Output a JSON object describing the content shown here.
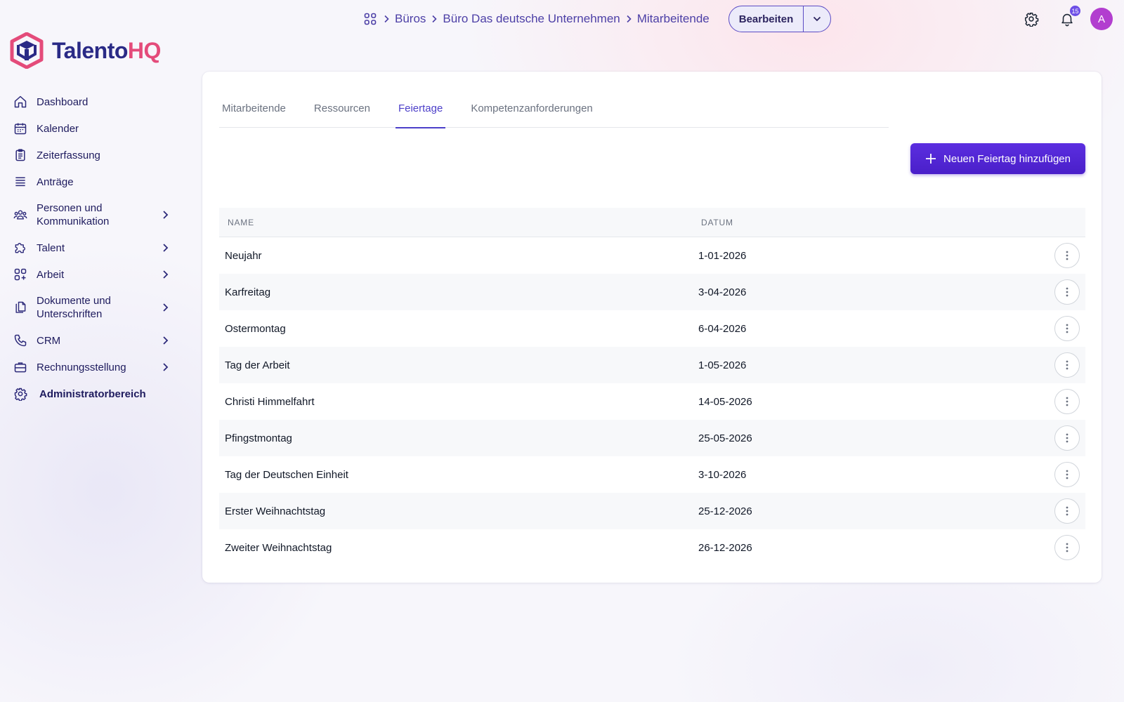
{
  "breadcrumb": {
    "icon": "apps-grid-icon",
    "items": [
      "Büros",
      "Büro Das deutsche Unternehmen",
      "Mitarbeitende"
    ]
  },
  "header": {
    "edit_label": "Bearbeiten",
    "notification_count": "15",
    "avatar_initial": "A"
  },
  "logo": {
    "part1": "Talento",
    "part2": "HQ"
  },
  "sidebar": {
    "items": [
      {
        "label": "Dashboard",
        "icon": "home-icon"
      },
      {
        "label": "Kalender",
        "icon": "calendar-icon"
      },
      {
        "label": "Zeiterfassung",
        "icon": "clipboard-icon"
      },
      {
        "label": "Anträge",
        "icon": "list-icon"
      },
      {
        "label": "Personen und Kommunikation",
        "icon": "people-icon",
        "expandable": true
      },
      {
        "label": "Talent",
        "icon": "puzzle-icon",
        "expandable": true
      },
      {
        "label": "Arbeit",
        "icon": "apps-add-icon",
        "expandable": true
      },
      {
        "label": "Dokumente und Unterschriften",
        "icon": "documents-icon",
        "expandable": true
      },
      {
        "label": "CRM",
        "icon": "phone-icon",
        "expandable": true
      },
      {
        "label": "Rechnungsstellung",
        "icon": "briefcase-icon",
        "expandable": true
      },
      {
        "label": "Administratorbereich",
        "icon": "gear-icon"
      }
    ]
  },
  "tabs": [
    {
      "label": "Mitarbeitende",
      "active": false
    },
    {
      "label": "Ressourcen",
      "active": false
    },
    {
      "label": "Feiertage",
      "active": true
    },
    {
      "label": "Kompetenzanforderungen",
      "active": false
    }
  ],
  "add_button_label": "Neuen Feiertag hinzufügen",
  "table": {
    "columns": [
      "NAME",
      "DATUM"
    ],
    "rows": [
      {
        "name": "Neujahr",
        "date": "1-01-2026"
      },
      {
        "name": "Karfreitag",
        "date": "3-04-2026"
      },
      {
        "name": "Ostermontag",
        "date": "6-04-2026"
      },
      {
        "name": "Tag der Arbeit",
        "date": "1-05-2026"
      },
      {
        "name": "Christi Himmelfahrt",
        "date": "14-05-2026"
      },
      {
        "name": "Pfingstmontag",
        "date": "25-05-2026"
      },
      {
        "name": "Tag der Deutschen Einheit",
        "date": "3-10-2026"
      },
      {
        "name": "Erster Weihnachtstag",
        "date": "25-12-2026"
      },
      {
        "name": "Zweiter Weihnachtstag",
        "date": "26-12-2026"
      }
    ]
  },
  "colors": {
    "brand_primary": "#2a2a86",
    "brand_accent": "#e44b7a",
    "button_primary": "#4a1fc9",
    "tab_active": "#4c3fc9",
    "avatar": "#b23ecf"
  }
}
